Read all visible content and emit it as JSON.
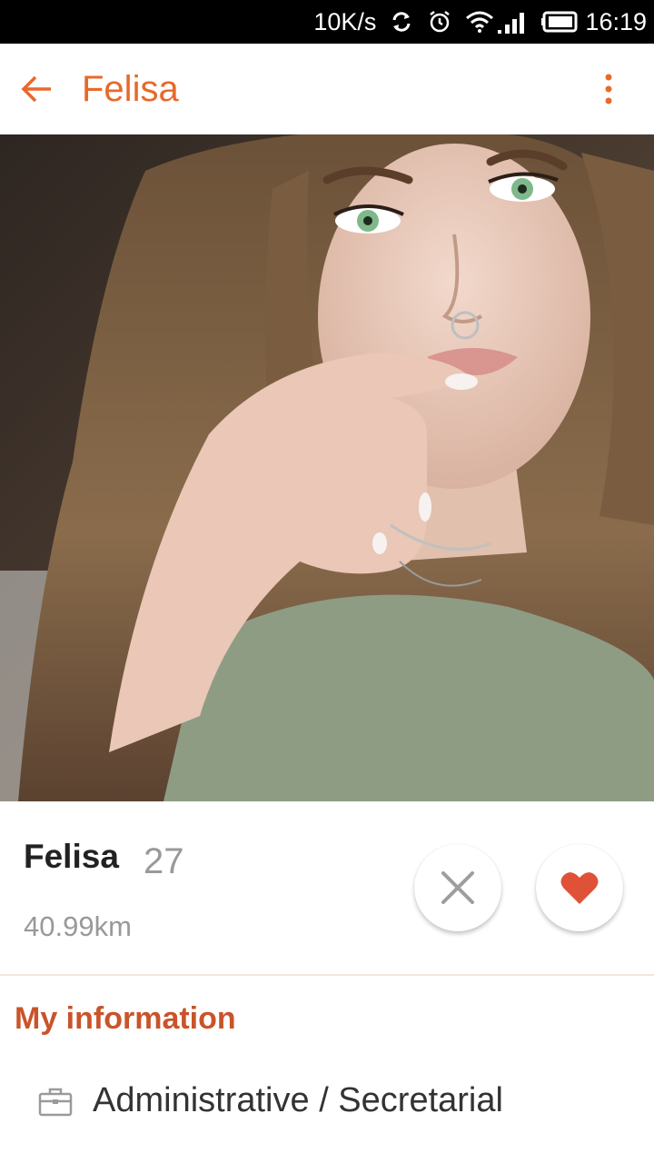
{
  "status_bar": {
    "network_speed": "10K/s",
    "icons": [
      "sync-icon",
      "alarm-icon",
      "wifi-icon",
      "signal-icon",
      "battery-icon"
    ],
    "time": "16:19"
  },
  "app_bar": {
    "title": "Felisa",
    "back_icon": "arrow-left-icon",
    "menu_icon": "more-vert-icon"
  },
  "profile": {
    "photo": "profile-photo",
    "name": "Felisa",
    "age": "27",
    "distance": "40.99km"
  },
  "actions": {
    "dislike_icon": "close-icon",
    "like_icon": "heart-icon"
  },
  "info_section": {
    "title": "My information",
    "items": [
      {
        "icon": "briefcase-icon",
        "text": "Administrative / Secretarial"
      }
    ]
  },
  "colors": {
    "accent": "#e8692a",
    "section_title": "#c9542a",
    "heart": "#e05238"
  }
}
